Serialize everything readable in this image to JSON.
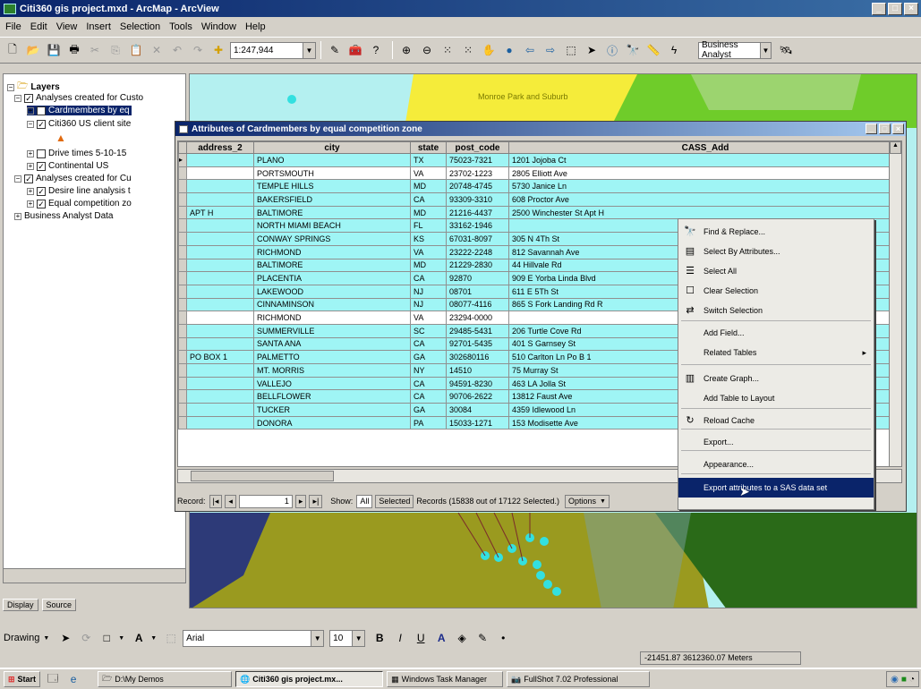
{
  "window": {
    "title": "Citi360 gis project.mxd - ArcMap - ArcView"
  },
  "menu": [
    "File",
    "Edit",
    "View",
    "Insert",
    "Selection",
    "Tools",
    "Window",
    "Help"
  ],
  "toolbar": {
    "scale": "1:247,944",
    "ba_menu": "Business Analyst"
  },
  "toc": {
    "layers_label": "Layers",
    "items": [
      "Analyses created for Custo",
      "Cardmembers by eq",
      "Citi360 US client site",
      "Drive times 5-10-15",
      "Continental US",
      "Analyses created for Cu",
      "Desire line analysis t",
      "Equal competition zo",
      "Business Analyst Data"
    ],
    "tab_display": "Display",
    "tab_source": "Source"
  },
  "map": {
    "poly_label": "Monroe Park and Suburb"
  },
  "attr": {
    "title": "Attributes of Cardmembers by equal competition zone",
    "columns": [
      "address_2",
      "city",
      "state",
      "post_code",
      "CASS_Add"
    ],
    "rows": [
      {
        "a2": "",
        "city": "PLANO",
        "st": "TX",
        "pc": "75023-7321",
        "addr": "1201 Jojoba Ct",
        "sel": true
      },
      {
        "a2": "",
        "city": "PORTSMOUTH",
        "st": "VA",
        "pc": "23702-1223",
        "addr": "2805 Elliott Ave",
        "sel": false
      },
      {
        "a2": "",
        "city": "TEMPLE HILLS",
        "st": "MD",
        "pc": "20748-4745",
        "addr": "5730 Janice Ln",
        "sel": true
      },
      {
        "a2": "",
        "city": "BAKERSFIELD",
        "st": "CA",
        "pc": "93309-3310",
        "addr": "608 Proctor Ave",
        "sel": true
      },
      {
        "a2": "APT H",
        "city": "BALTIMORE",
        "st": "MD",
        "pc": "21216-4437",
        "addr": "2500 Winchester St Apt H",
        "sel": true
      },
      {
        "a2": "",
        "city": "NORTH MIAMI BEACH",
        "st": "FL",
        "pc": "33162-1946",
        "addr": "",
        "sel": true
      },
      {
        "a2": "",
        "city": "CONWAY SPRINGS",
        "st": "KS",
        "pc": "67031-8097",
        "addr": "305 N 4Th St",
        "sel": true
      },
      {
        "a2": "",
        "city": "RICHMOND",
        "st": "VA",
        "pc": "23222-2248",
        "addr": "812 Savannah Ave",
        "sel": true
      },
      {
        "a2": "",
        "city": "BALTIMORE",
        "st": "MD",
        "pc": "21229-2830",
        "addr": "44 Hillvale Rd",
        "sel": true
      },
      {
        "a2": "",
        "city": "PLACENTIA",
        "st": "CA",
        "pc": "92870",
        "addr": "909 E Yorba Linda Blvd",
        "sel": true
      },
      {
        "a2": "",
        "city": "LAKEWOOD",
        "st": "NJ",
        "pc": "08701",
        "addr": "611 E 5Th St",
        "sel": true
      },
      {
        "a2": "",
        "city": "CINNAMINSON",
        "st": "NJ",
        "pc": "08077-4116",
        "addr": "865 S Fork Landing Rd R",
        "sel": true
      },
      {
        "a2": "",
        "city": "RICHMOND",
        "st": "VA",
        "pc": "23294-0000",
        "addr": "",
        "sel": false
      },
      {
        "a2": "",
        "city": "SUMMERVILLE",
        "st": "SC",
        "pc": "29485-5431",
        "addr": "206 Turtle Cove Rd",
        "sel": true
      },
      {
        "a2": "",
        "city": "SANTA ANA",
        "st": "CA",
        "pc": "92701-5435",
        "addr": "401 S Garnsey St",
        "sel": true
      },
      {
        "a2": "PO BOX 1",
        "city": "PALMETTO",
        "st": "GA",
        "pc": "302680116",
        "addr": "510 Carlton Ln Po B 1",
        "sel": true
      },
      {
        "a2": "",
        "city": "MT. MORRIS",
        "st": "NY",
        "pc": "14510",
        "addr": "75 Murray St",
        "sel": true
      },
      {
        "a2": "",
        "city": "VALLEJO",
        "st": "CA",
        "pc": "94591-8230",
        "addr": "463 LA Jolla St",
        "sel": true
      },
      {
        "a2": "",
        "city": "BELLFLOWER",
        "st": "CA",
        "pc": "90706-2622",
        "addr": "13812 Faust Ave",
        "sel": true
      },
      {
        "a2": "",
        "city": "TUCKER",
        "st": "GA",
        "pc": "30084",
        "addr": "4359 Idlewood Ln",
        "sel": true
      },
      {
        "a2": "",
        "city": "DONORA",
        "st": "PA",
        "pc": "15033-1271",
        "addr": "153 Modisette Ave",
        "sel": true
      }
    ],
    "record_label": "Record:",
    "record_value": "1",
    "show_label": "Show:",
    "btn_all": "All",
    "btn_selected": "Selected",
    "records_text": "Records (15838 out of 17122 Selected.)",
    "options": "Options"
  },
  "context_menu": [
    {
      "label": "Find & Replace...",
      "icon": "binoculars-icon",
      "glyph": "🔭"
    },
    {
      "label": "Select By Attributes...",
      "icon": "select-attributes-icon",
      "glyph": "▤"
    },
    {
      "label": "Select All",
      "icon": "select-all-icon",
      "glyph": "☰"
    },
    {
      "label": "Clear Selection",
      "icon": "clear-selection-icon",
      "glyph": "☐"
    },
    {
      "label": "Switch Selection",
      "icon": "switch-selection-icon",
      "glyph": "⇄"
    },
    {
      "label": "Add Field...",
      "icon": "",
      "glyph": ""
    },
    {
      "label": "Related Tables",
      "icon": "",
      "glyph": "",
      "arrow": "▸"
    },
    {
      "label": "Create Graph...",
      "icon": "graph-icon",
      "glyph": "▥"
    },
    {
      "label": "Add Table to Layout",
      "icon": "",
      "glyph": ""
    },
    {
      "label": "Reload Cache",
      "icon": "reload-icon",
      "glyph": "↻"
    },
    {
      "label": "Export...",
      "icon": "",
      "glyph": ""
    },
    {
      "label": "Appearance...",
      "icon": "",
      "glyph": ""
    },
    {
      "label": "Export attributes to a SAS data set",
      "icon": "",
      "glyph": ""
    }
  ],
  "drawing": {
    "label": "Drawing",
    "font": "Arial",
    "size": "10"
  },
  "status": {
    "coords": "-21451.87  3612360.07 Meters"
  },
  "taskbar": {
    "start": "Start",
    "items": [
      "D:\\My Demos",
      "Citi360 gis project.mx...",
      "Windows Task Manager",
      "FullShot 7.02 Professional"
    ]
  }
}
